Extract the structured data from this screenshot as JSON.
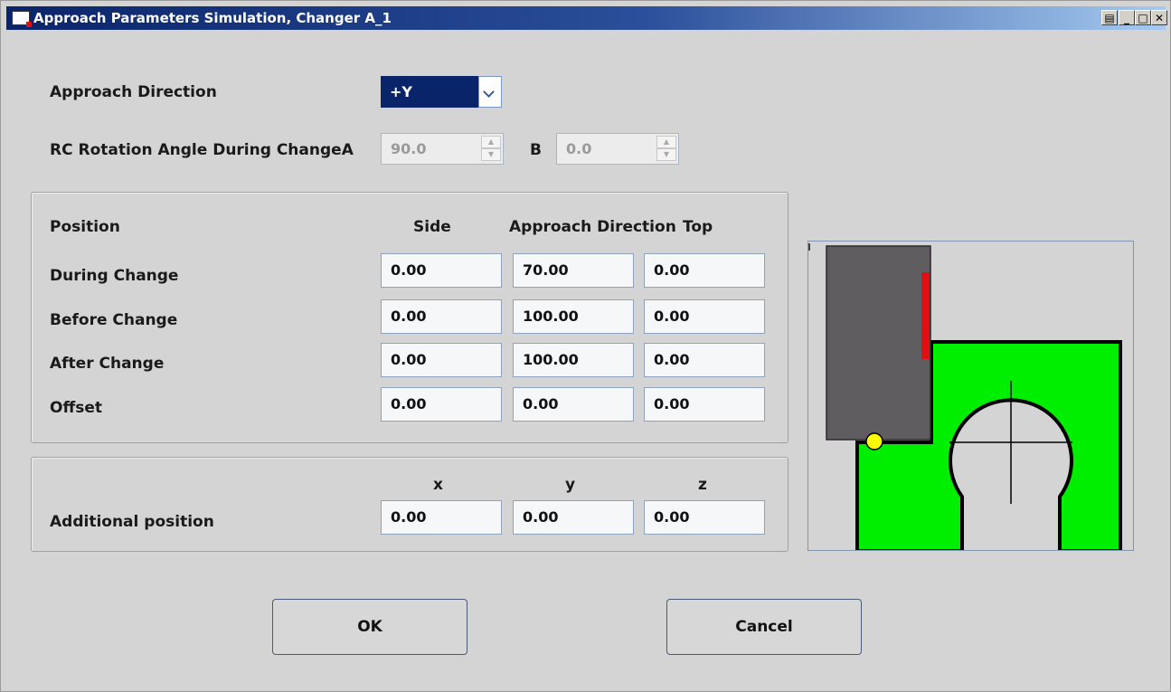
{
  "window": {
    "title": "Approach Parameters Simulation, Changer A_1"
  },
  "approach_direction": {
    "label": "Approach Direction",
    "value": "+Y"
  },
  "rotation": {
    "label": "RC Rotation Angle During Change",
    "a_label": "A",
    "a_value": "90.0",
    "b_label": "B",
    "b_value": "0.0"
  },
  "position_table": {
    "header": {
      "position": "Position",
      "side": "Side",
      "approach": "Approach Direction",
      "top": "Top"
    },
    "rows": [
      {
        "label": "During Change",
        "side": "0.00",
        "approach": "70.00",
        "top": "0.00"
      },
      {
        "label": "Before Change",
        "side": "0.00",
        "approach": "100.00",
        "top": "0.00"
      },
      {
        "label": "After Change",
        "side": "0.00",
        "approach": "100.00",
        "top": "0.00"
      },
      {
        "label": "Offset",
        "side": "0.00",
        "approach": "0.00",
        "top": "0.00"
      }
    ]
  },
  "additional": {
    "x_label": "x",
    "y_label": "y",
    "z_label": "z",
    "label": "Additional position",
    "x": "0.00",
    "y": "0.00",
    "z": "0.00"
  },
  "buttons": {
    "ok": "OK",
    "cancel": "Cancel"
  },
  "colors": {
    "title_start": "#0a246a",
    "title_end": "#a6caf0",
    "selection": "#0a246a",
    "shuttle": "#605d61",
    "marker": "#e01010",
    "base": "#00ee00",
    "point": "#ffff00"
  }
}
